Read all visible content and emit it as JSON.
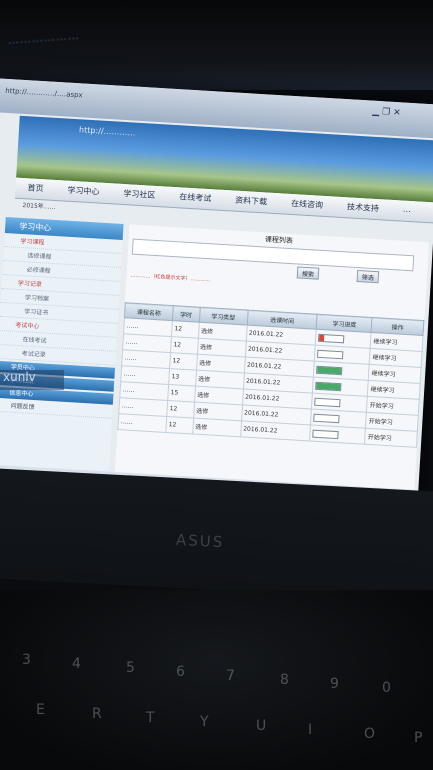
{
  "photo": {
    "top_blurred_title": "………………",
    "watermark": "xunlv",
    "brand": "ASUS"
  },
  "browser": {
    "url": "http://…………/….aspx",
    "window_buttons": "▁ ❐ ✕"
  },
  "banner": {
    "url": "http://…………"
  },
  "nav": {
    "items": [
      "首页",
      "学习中心",
      "学习社区",
      "在线考试",
      "资料下载",
      "在线咨询",
      "技术支持",
      "…"
    ]
  },
  "info_bar": "2015年……",
  "sidebar": {
    "header": "学习中心",
    "items": [
      {
        "label": "学习课程",
        "style": "red"
      },
      {
        "label": "选修课程",
        "style": "sub"
      },
      {
        "label": "必修课程",
        "style": "sub"
      },
      {
        "label": "学习记录",
        "style": "red"
      },
      {
        "label": "学习档案",
        "style": "sub"
      },
      {
        "label": "学习证书",
        "style": "sub"
      },
      {
        "label": "考试中心",
        "style": "red"
      },
      {
        "label": "在线考试",
        "style": "sub"
      },
      {
        "label": "考试记录",
        "style": "sub"
      }
    ],
    "blue_bars": [
      "学员中心",
      "学习社区",
      "信息中心"
    ],
    "footer_link": "问题反馈"
  },
  "main": {
    "title": "课程列表",
    "search_btn": "搜索",
    "filter_btn": "筛选",
    "notice": "…………（红色提示文字）…………",
    "columns": [
      "课程名称",
      "学时",
      "学习类型",
      "选课时间",
      "学习进度",
      "操作"
    ],
    "rows": [
      {
        "title": "……",
        "hours": "12",
        "type": "选修",
        "date": "2016.01.22",
        "progress": 0.2,
        "red": true,
        "action": "继续学习"
      },
      {
        "title": "……",
        "hours": "12",
        "type": "选修",
        "date": "2016.01.22",
        "progress": 0.0,
        "red": false,
        "action": "继续学习"
      },
      {
        "title": "……",
        "hours": "12",
        "type": "选修",
        "date": "2016.01.22",
        "progress": 1.0,
        "red": false,
        "action": "继续学习"
      },
      {
        "title": "……",
        "hours": "13",
        "type": "选修",
        "date": "2016.01.22",
        "progress": 1.0,
        "red": false,
        "action": "继续学习"
      },
      {
        "title": "……",
        "hours": "15",
        "type": "选修",
        "date": "2016.01.22",
        "progress": 0.0,
        "red": false,
        "action": "开始学习"
      },
      {
        "title": "……",
        "hours": "12",
        "type": "选修",
        "date": "2016.01.22",
        "progress": 0.0,
        "red": false,
        "action": "开始学习"
      },
      {
        "title": "……",
        "hours": "12",
        "type": "选修",
        "date": "2016.01.22",
        "progress": 0.0,
        "red": false,
        "action": "开始学习"
      }
    ]
  },
  "keyboard": {
    "keys": [
      "3",
      "4",
      "5",
      "6",
      "7",
      "8",
      "9",
      "0",
      "E",
      "R",
      "T",
      "Y",
      "U",
      "I",
      "O",
      "P"
    ]
  }
}
